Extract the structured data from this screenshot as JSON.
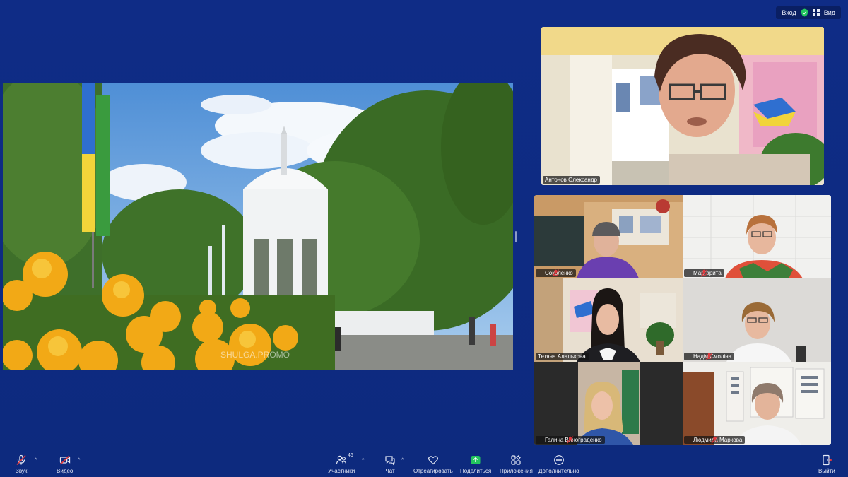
{
  "top_bar": {
    "entry_label": "Вход",
    "view_label": "Вид",
    "shield_icon": "shield-check-icon",
    "view_icon": "grid-icon"
  },
  "shared_screen": {
    "watermark": "SHULGA.PROMO"
  },
  "speaker": {
    "name": "Антонов Олександр"
  },
  "participants": [
    {
      "name": "Соколенко",
      "muted": true
    },
    {
      "name": "Маргарита",
      "muted": true
    },
    {
      "name": "Тетяна Алалькова",
      "muted": false
    },
    {
      "name": "Надія Смоліна",
      "muted": true
    },
    {
      "name": "Галина Винограденко",
      "muted": true
    },
    {
      "name": "Людмила Маркова",
      "muted": true
    }
  ],
  "toolbar": {
    "audio_label": "Звук",
    "video_label": "Видео",
    "participants_label": "Участники",
    "participants_count": "46",
    "chat_label": "Чат",
    "react_label": "Отреагировать",
    "share_label": "Поделиться",
    "apps_label": "Приложения",
    "more_label": "Дополнительно",
    "leave_label": "Выйти"
  },
  "colors": {
    "background": "#0d2a7e",
    "share_accent": "#23c55e",
    "leave_red": "#e0393e"
  }
}
